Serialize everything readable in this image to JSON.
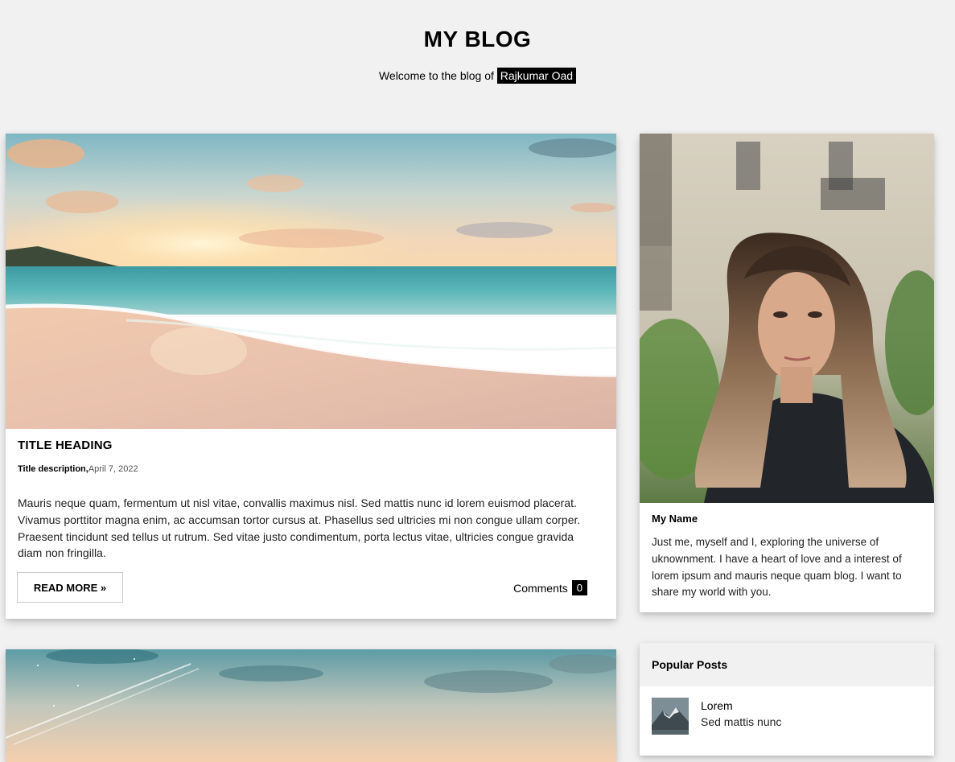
{
  "header": {
    "title": "MY BLOG",
    "welcome_prefix": "Welcome to the blog of",
    "author": "Rajkumar Oad"
  },
  "posts": [
    {
      "image": "beach-sunset-image",
      "title": "TITLE HEADING",
      "description": "Title description,",
      "date": "April 7, 2022",
      "body": "Mauris neque quam, fermentum ut nisl vitae, convallis maximus nisl. Sed mattis nunc id lorem euismod placerat. Vivamus porttitor magna enim, ac accumsan tortor cursus at. Phasellus sed ultricies mi non congue ullam corper. Praesent tincidunt sed tellus ut rutrum. Sed vitae justo condimentum, porta lectus vitae, ultricies congue gravida diam non fringilla.",
      "read_more": "READ MORE »",
      "comments_label": "Comments",
      "comments_count": "0"
    },
    {
      "image": "pastel-sky-image"
    }
  ],
  "about": {
    "image": "portrait-photo",
    "name": "My Name",
    "text": "Just me, myself and I, exploring the universe of uknownment. I have a heart of love and a interest of lorem ipsum and mauris neque quam blog. I want to share my world with you."
  },
  "popular": {
    "title": "Popular Posts",
    "items": [
      {
        "thumb": "mountain-thumbnail",
        "title": "Lorem",
        "subtitle": "Sed mattis nunc"
      }
    ]
  }
}
